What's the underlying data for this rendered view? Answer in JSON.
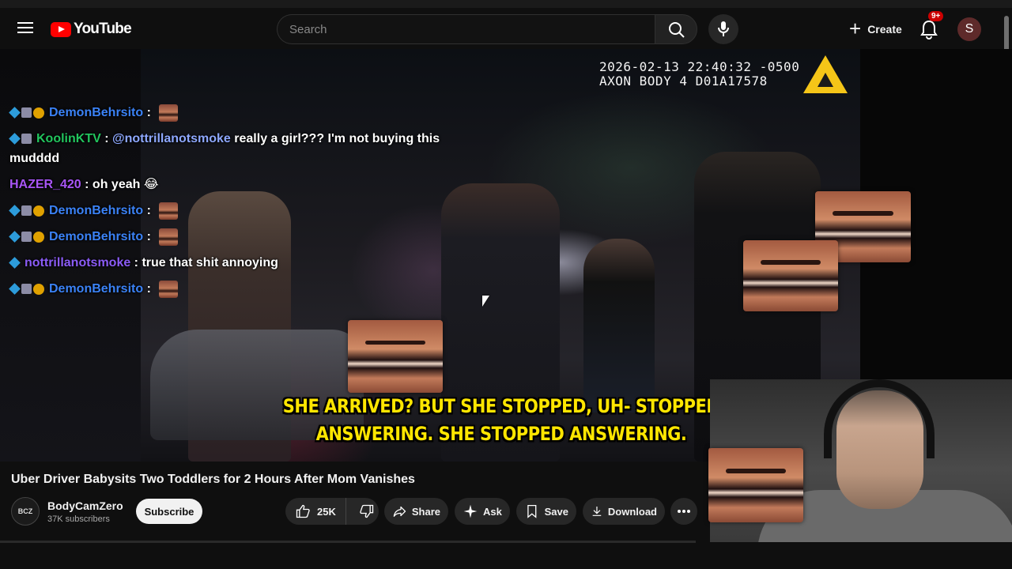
{
  "header": {
    "logo_text": "YouTube",
    "search_placeholder": "Search",
    "create_label": "Create",
    "notification_badge": "9+",
    "avatar_letter": "S"
  },
  "video": {
    "timestamp_line1": "2026-02-13 22:40:32 -0500",
    "timestamp_line2": "AXON BODY 4 D01A17578",
    "caption_line1": "SHE ARRIVED? BUT SHE STOPPED, UH- STOPPED",
    "caption_line2": "ANSWERING. SHE STOPPED ANSWERING."
  },
  "chat": [
    {
      "user": "DemonBehrsito",
      "badges": [
        "blue",
        "gray",
        "gold"
      ],
      "color": "#3b82f6",
      "message": "",
      "emote": true
    },
    {
      "user": "KoolinKTV",
      "badges": [
        "blue",
        "gray"
      ],
      "color": "#22c55e",
      "mention": "@nottrillanotsmoke",
      "message": "really a girl??? I'm not buying this mudddd",
      "emote": false
    },
    {
      "user": "HAZER_420",
      "badges": [],
      "color": "#a855f7",
      "message": "oh yeah 😂",
      "emote": false
    },
    {
      "user": "DemonBehrsito",
      "badges": [
        "blue",
        "gray",
        "gold"
      ],
      "color": "#3b82f6",
      "message": "",
      "emote": true
    },
    {
      "user": "DemonBehrsito",
      "badges": [
        "blue",
        "gray",
        "gold"
      ],
      "color": "#3b82f6",
      "message": "",
      "emote": true
    },
    {
      "user": "nottrillanotsmoke",
      "badges": [
        "blue"
      ],
      "color": "#8b5cf6",
      "message": "true that shit annoying",
      "emote": false
    },
    {
      "user": "DemonBehrsito",
      "badges": [
        "blue",
        "gray",
        "gold"
      ],
      "color": "#3b82f6",
      "message": "",
      "emote": true
    }
  ],
  "info": {
    "title": "Uber Driver Babysits Two Toddlers for 2 Hours After Mom Vanishes",
    "channel_avatar_text": "BCZ",
    "channel_name": "BodyCamZero",
    "subscribers": "37K subscribers",
    "subscribe_label": "Subscribe",
    "like_count": "25K",
    "share_label": "Share",
    "ask_label": "Ask",
    "save_label": "Save",
    "download_label": "Download"
  },
  "icons": [
    "menu-icon",
    "youtube-logo-icon",
    "search-icon",
    "mic-icon",
    "plus-icon",
    "bell-icon",
    "like-icon",
    "dislike-icon",
    "share-icon",
    "sparkle-icon",
    "bookmark-icon",
    "download-icon",
    "more-icon"
  ]
}
